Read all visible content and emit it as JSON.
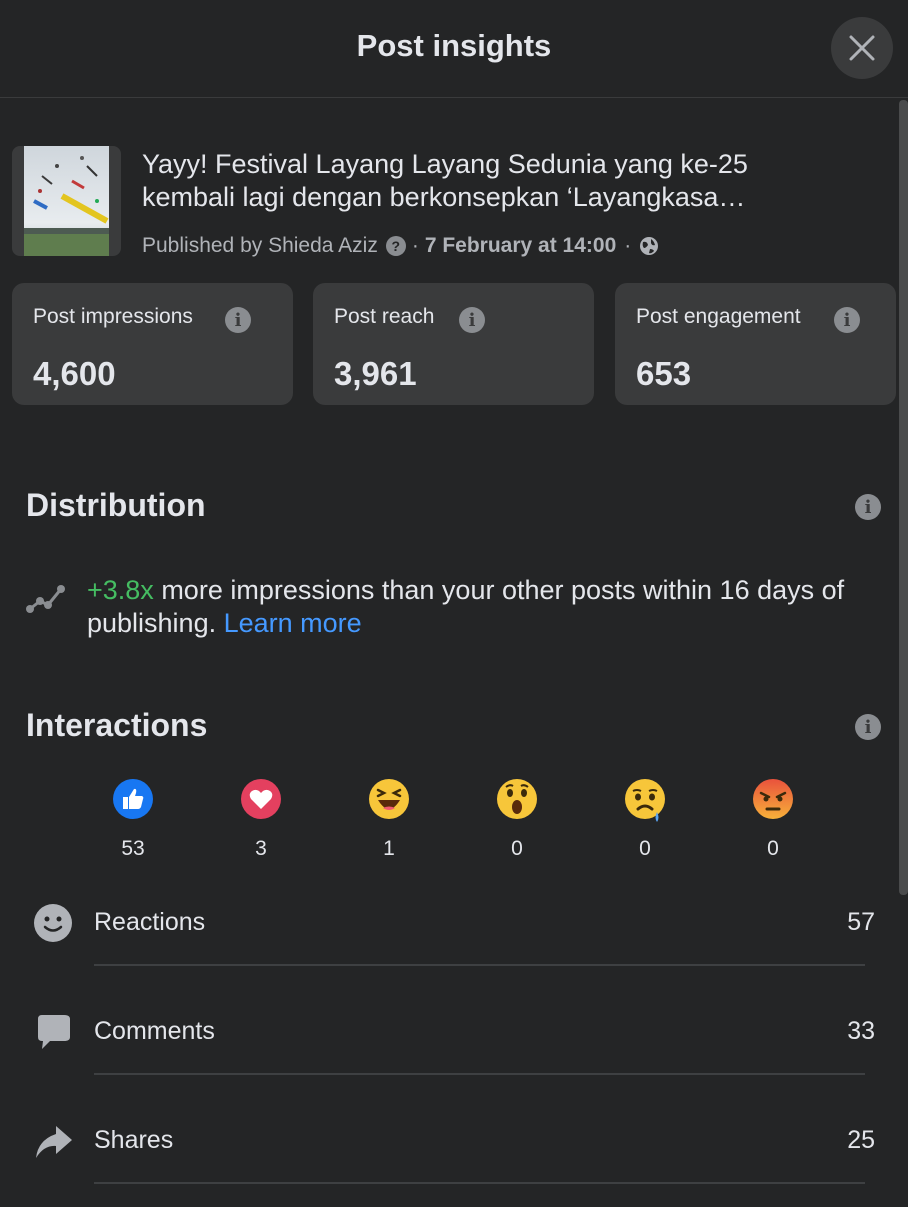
{
  "header": {
    "title": "Post insights"
  },
  "post": {
    "text": "Yayy! Festival Layang Layang Sedunia yang ke-25 kembali lagi dengan berkonsepkan ‘Layangkasa…",
    "published_by": "Published by Shieda Aziz",
    "separator": "·",
    "date": "7 February at 14:00"
  },
  "metrics": [
    {
      "label": "Post impressions",
      "value": "4,600"
    },
    {
      "label": "Post reach",
      "value": "3,961"
    },
    {
      "label": "Post engagement",
      "value": "653"
    }
  ],
  "distribution": {
    "title": "Distribution",
    "accent": "+3.8x",
    "text": " more impressions than your other posts within 16 days of publishing. ",
    "link": "Learn more"
  },
  "interactions": {
    "title": "Interactions",
    "reactions": [
      {
        "name": "like",
        "count": "53"
      },
      {
        "name": "love",
        "count": "3"
      },
      {
        "name": "haha",
        "count": "1"
      },
      {
        "name": "wow",
        "count": "0"
      },
      {
        "name": "sad",
        "count": "0"
      },
      {
        "name": "angry",
        "count": "0"
      }
    ],
    "stats": [
      {
        "label": "Reactions",
        "value": "57",
        "icon": "smiley-icon"
      },
      {
        "label": "Comments",
        "value": "33",
        "icon": "comment-icon"
      },
      {
        "label": "Shares",
        "value": "25",
        "icon": "share-icon"
      }
    ]
  },
  "colors": {
    "background": "#242526",
    "card": "#3a3b3c",
    "accent_green": "#45bd62",
    "link_blue": "#4599ff"
  }
}
